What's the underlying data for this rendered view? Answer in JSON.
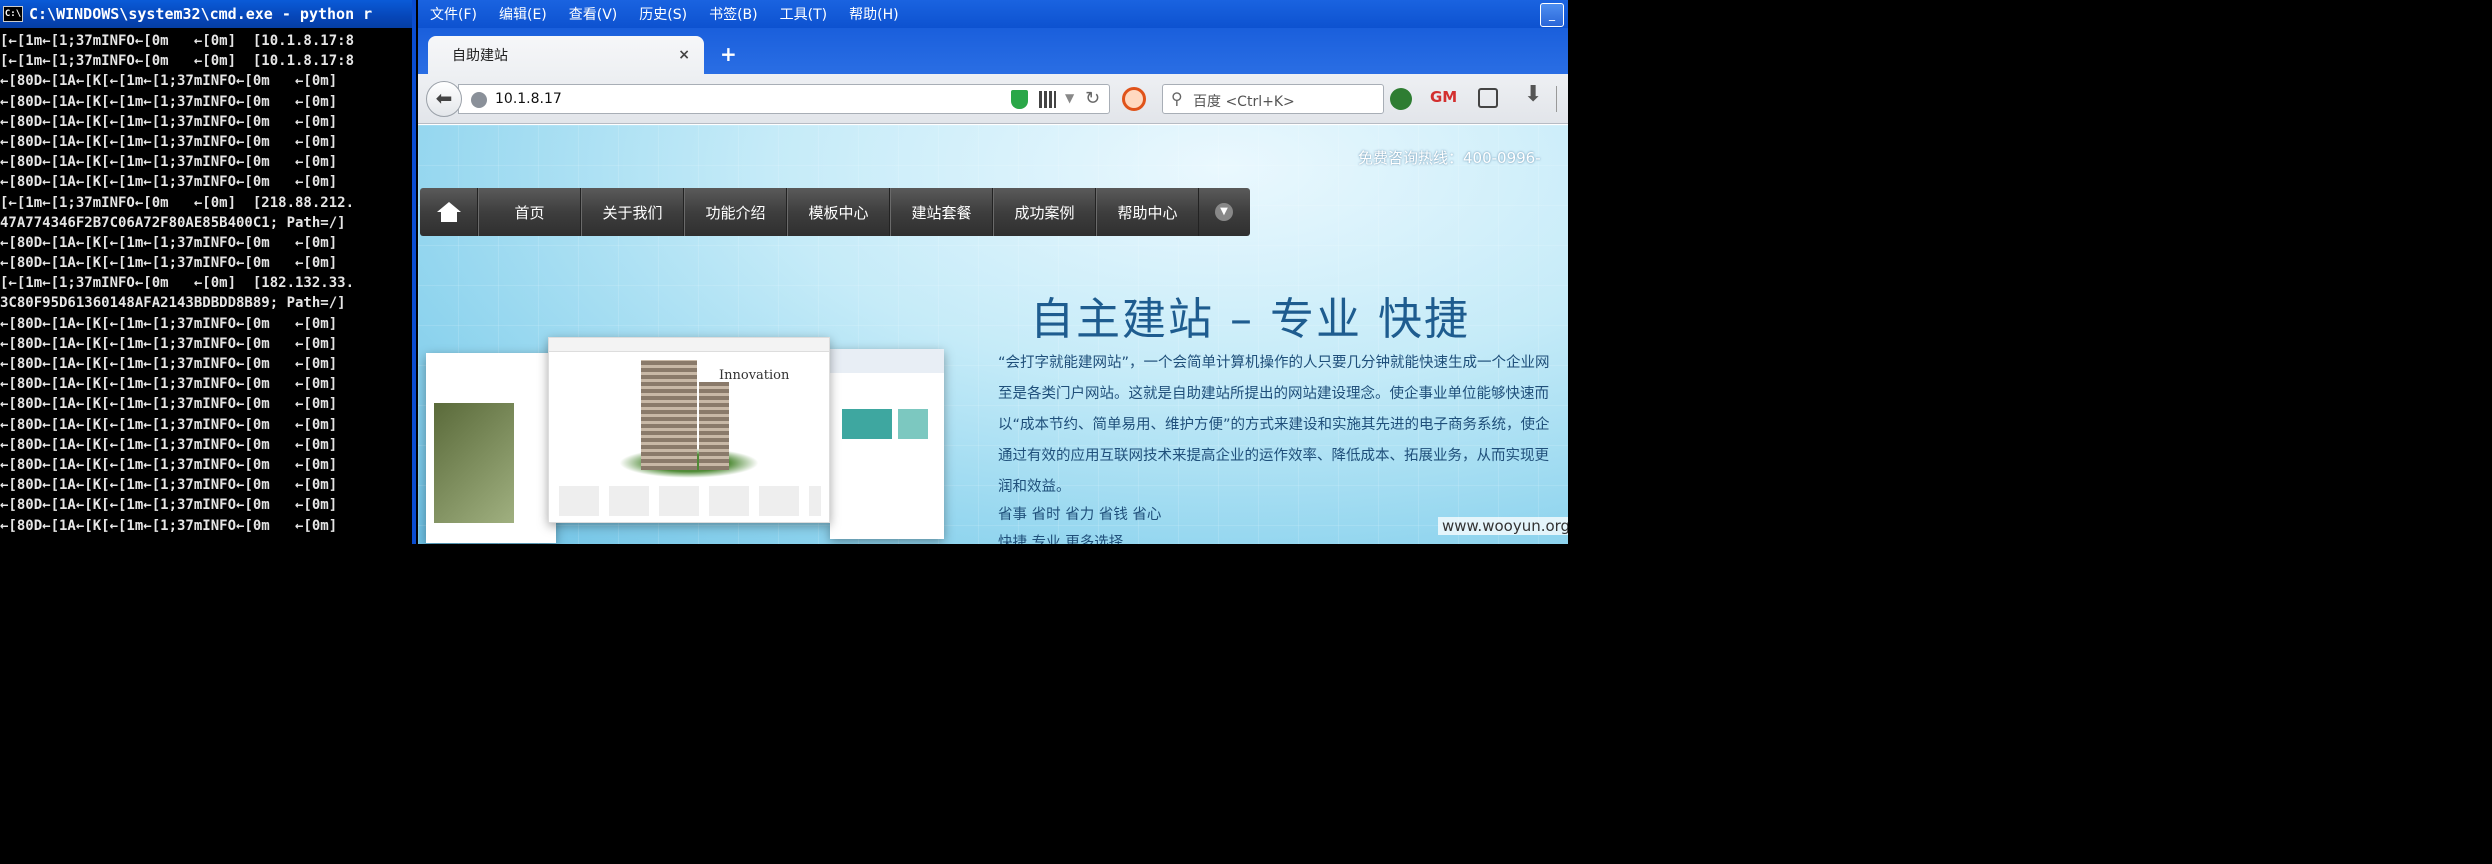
{
  "cmd": {
    "title": "C:\\WINDOWS\\system32\\cmd.exe - python r",
    "lines": [
      "[←[1m←[1;37mINFO←[0m   ←[0m]  [10.1.8.17:8",
      "[←[1m←[1;37mINFO←[0m   ←[0m]  [10.1.8.17:8",
      "←[80D←[1A←[K[←[1m←[1;37mINFO←[0m   ←[0m]",
      "←[80D←[1A←[K[←[1m←[1;37mINFO←[0m   ←[0m]",
      "←[80D←[1A←[K[←[1m←[1;37mINFO←[0m   ←[0m]",
      "←[80D←[1A←[K[←[1m←[1;37mINFO←[0m   ←[0m]",
      "←[80D←[1A←[K[←[1m←[1;37mINFO←[0m   ←[0m]",
      "←[80D←[1A←[K[←[1m←[1;37mINFO←[0m   ←[0m]",
      "[←[1m←[1;37mINFO←[0m   ←[0m]  [218.88.212.",
      "47A774346F2B7C06A72F80AE85B400C1; Path=/]",
      "←[80D←[1A←[K[←[1m←[1;37mINFO←[0m   ←[0m]",
      "←[80D←[1A←[K[←[1m←[1;37mINFO←[0m   ←[0m]",
      "[←[1m←[1;37mINFO←[0m   ←[0m]  [182.132.33.",
      "3C80F95D61360148AFA2143BDBDD8B89; Path=/]",
      "←[80D←[1A←[K[←[1m←[1;37mINFO←[0m   ←[0m]",
      "←[80D←[1A←[K[←[1m←[1;37mINFO←[0m   ←[0m]",
      "←[80D←[1A←[K[←[1m←[1;37mINFO←[0m   ←[0m]",
      "←[80D←[1A←[K[←[1m←[1;37mINFO←[0m   ←[0m]",
      "←[80D←[1A←[K[←[1m←[1;37mINFO←[0m   ←[0m]",
      "←[80D←[1A←[K[←[1m←[1;37mINFO←[0m   ←[0m]",
      "←[80D←[1A←[K[←[1m←[1;37mINFO←[0m   ←[0m]",
      "←[80D←[1A←[K[←[1m←[1;37mINFO←[0m   ←[0m]",
      "←[80D←[1A←[K[←[1m←[1;37mINFO←[0m   ←[0m]",
      "←[80D←[1A←[K[←[1m←[1;37mINFO←[0m   ←[0m]",
      "←[80D←[1A←[K[←[1m←[1;37mINFO←[0m   ←[0m]"
    ]
  },
  "browser": {
    "menu": [
      "文件(F)",
      "编辑(E)",
      "查看(V)",
      "历史(S)",
      "书签(B)",
      "工具(T)",
      "帮助(H)"
    ],
    "tab": {
      "title": "自助建站",
      "close": "×",
      "new_tab": "+"
    },
    "url": "10.1.8.17",
    "search_placeholder": "百度 <Ctrl+K>",
    "icons": [
      "back-icon",
      "globe-icon",
      "shield-icon",
      "qr-code-icon",
      "dropdown-icon",
      "reload-icon",
      "block-icon",
      "search-icon",
      "extension-icon",
      "gm-icon",
      "reader-icon",
      "download-icon"
    ]
  },
  "page": {
    "hotline": "免费咨询热线：400-0996-",
    "nav": [
      "首页",
      "关于我们",
      "功能介绍",
      "模板中心",
      "建站套餐",
      "成功案例",
      "帮助中心"
    ],
    "headline": "自主建站 – 专业 快捷",
    "description": [
      "“会打字就能建网站”，一个会简单计算机操作的人只要几分钟就能快速生成一个企业网",
      "至是各类门户网站。这就是自助建站所提出的网站建设理念。使企事业单位能够快速而",
      "以“成本节约、简单易用、维护方便”的方式来建设和实施其先进的电子商务系统，使企",
      "通过有效的应用互联网技术来提高企业的运作效率、降低成本、拓展业务，从而实现更",
      "润和效益。"
    ],
    "features": "省事 省时 省力 省钱 省心",
    "more": "快捷 专业 更多选择",
    "mock_label": "Innovation",
    "watermark": "www.wooyun.org"
  }
}
